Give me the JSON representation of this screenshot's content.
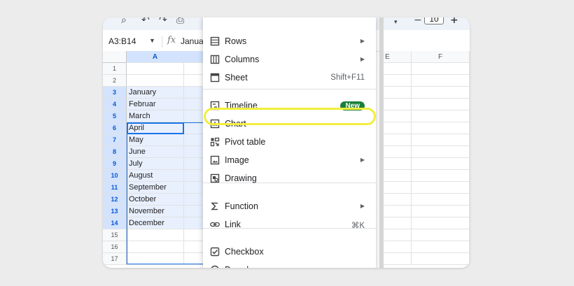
{
  "toolbar": {
    "font_size": "10",
    "minus": "−",
    "plus": "+"
  },
  "formula_bar": {
    "name_box": "A3:B14",
    "fx": "fx",
    "value": "Januar"
  },
  "columns": [
    "A",
    "E",
    "F"
  ],
  "rows": [
    {
      "n": "1",
      "a": ""
    },
    {
      "n": "2",
      "a": ""
    },
    {
      "n": "3",
      "a": "January"
    },
    {
      "n": "4",
      "a": "Februar"
    },
    {
      "n": "5",
      "a": "March"
    },
    {
      "n": "6",
      "a": "April"
    },
    {
      "n": "7",
      "a": "May"
    },
    {
      "n": "8",
      "a": "June"
    },
    {
      "n": "9",
      "a": "July"
    },
    {
      "n": "10",
      "a": "August"
    },
    {
      "n": "11",
      "a": "September"
    },
    {
      "n": "12",
      "a": "October"
    },
    {
      "n": "13",
      "a": "November"
    },
    {
      "n": "14",
      "a": "December"
    },
    {
      "n": "15",
      "a": ""
    },
    {
      "n": "16",
      "a": ""
    },
    {
      "n": "17",
      "a": ""
    }
  ],
  "menu": {
    "items": [
      {
        "label": "Rows",
        "icon": "rows-icon",
        "arrow": "▶"
      },
      {
        "label": "Columns",
        "icon": "columns-icon",
        "arrow": "▶"
      },
      {
        "label": "Sheet",
        "icon": "sheet-icon",
        "shortcut": "Shift+F11"
      },
      {
        "label": "Timeline",
        "icon": "timeline-icon",
        "badge": "New"
      },
      {
        "label": "Chart",
        "icon": "chart-icon"
      },
      {
        "label": "Pivot table",
        "icon": "pivot-table-icon"
      },
      {
        "label": "Image",
        "icon": "image-icon",
        "arrow": "▶"
      },
      {
        "label": "Drawing",
        "icon": "drawing-icon"
      },
      {
        "label": "Function",
        "icon": "function-icon",
        "arrow": "▶"
      },
      {
        "label": "Link",
        "icon": "link-icon",
        "shortcut": "⌘K"
      },
      {
        "label": "Checkbox",
        "icon": "checkbox-icon"
      },
      {
        "label": "Dropdown",
        "icon": "dropdown-icon"
      }
    ]
  },
  "colors": {
    "accent": "#1a73e8",
    "highlight": "#f1ee3c",
    "badge": "#188038"
  }
}
